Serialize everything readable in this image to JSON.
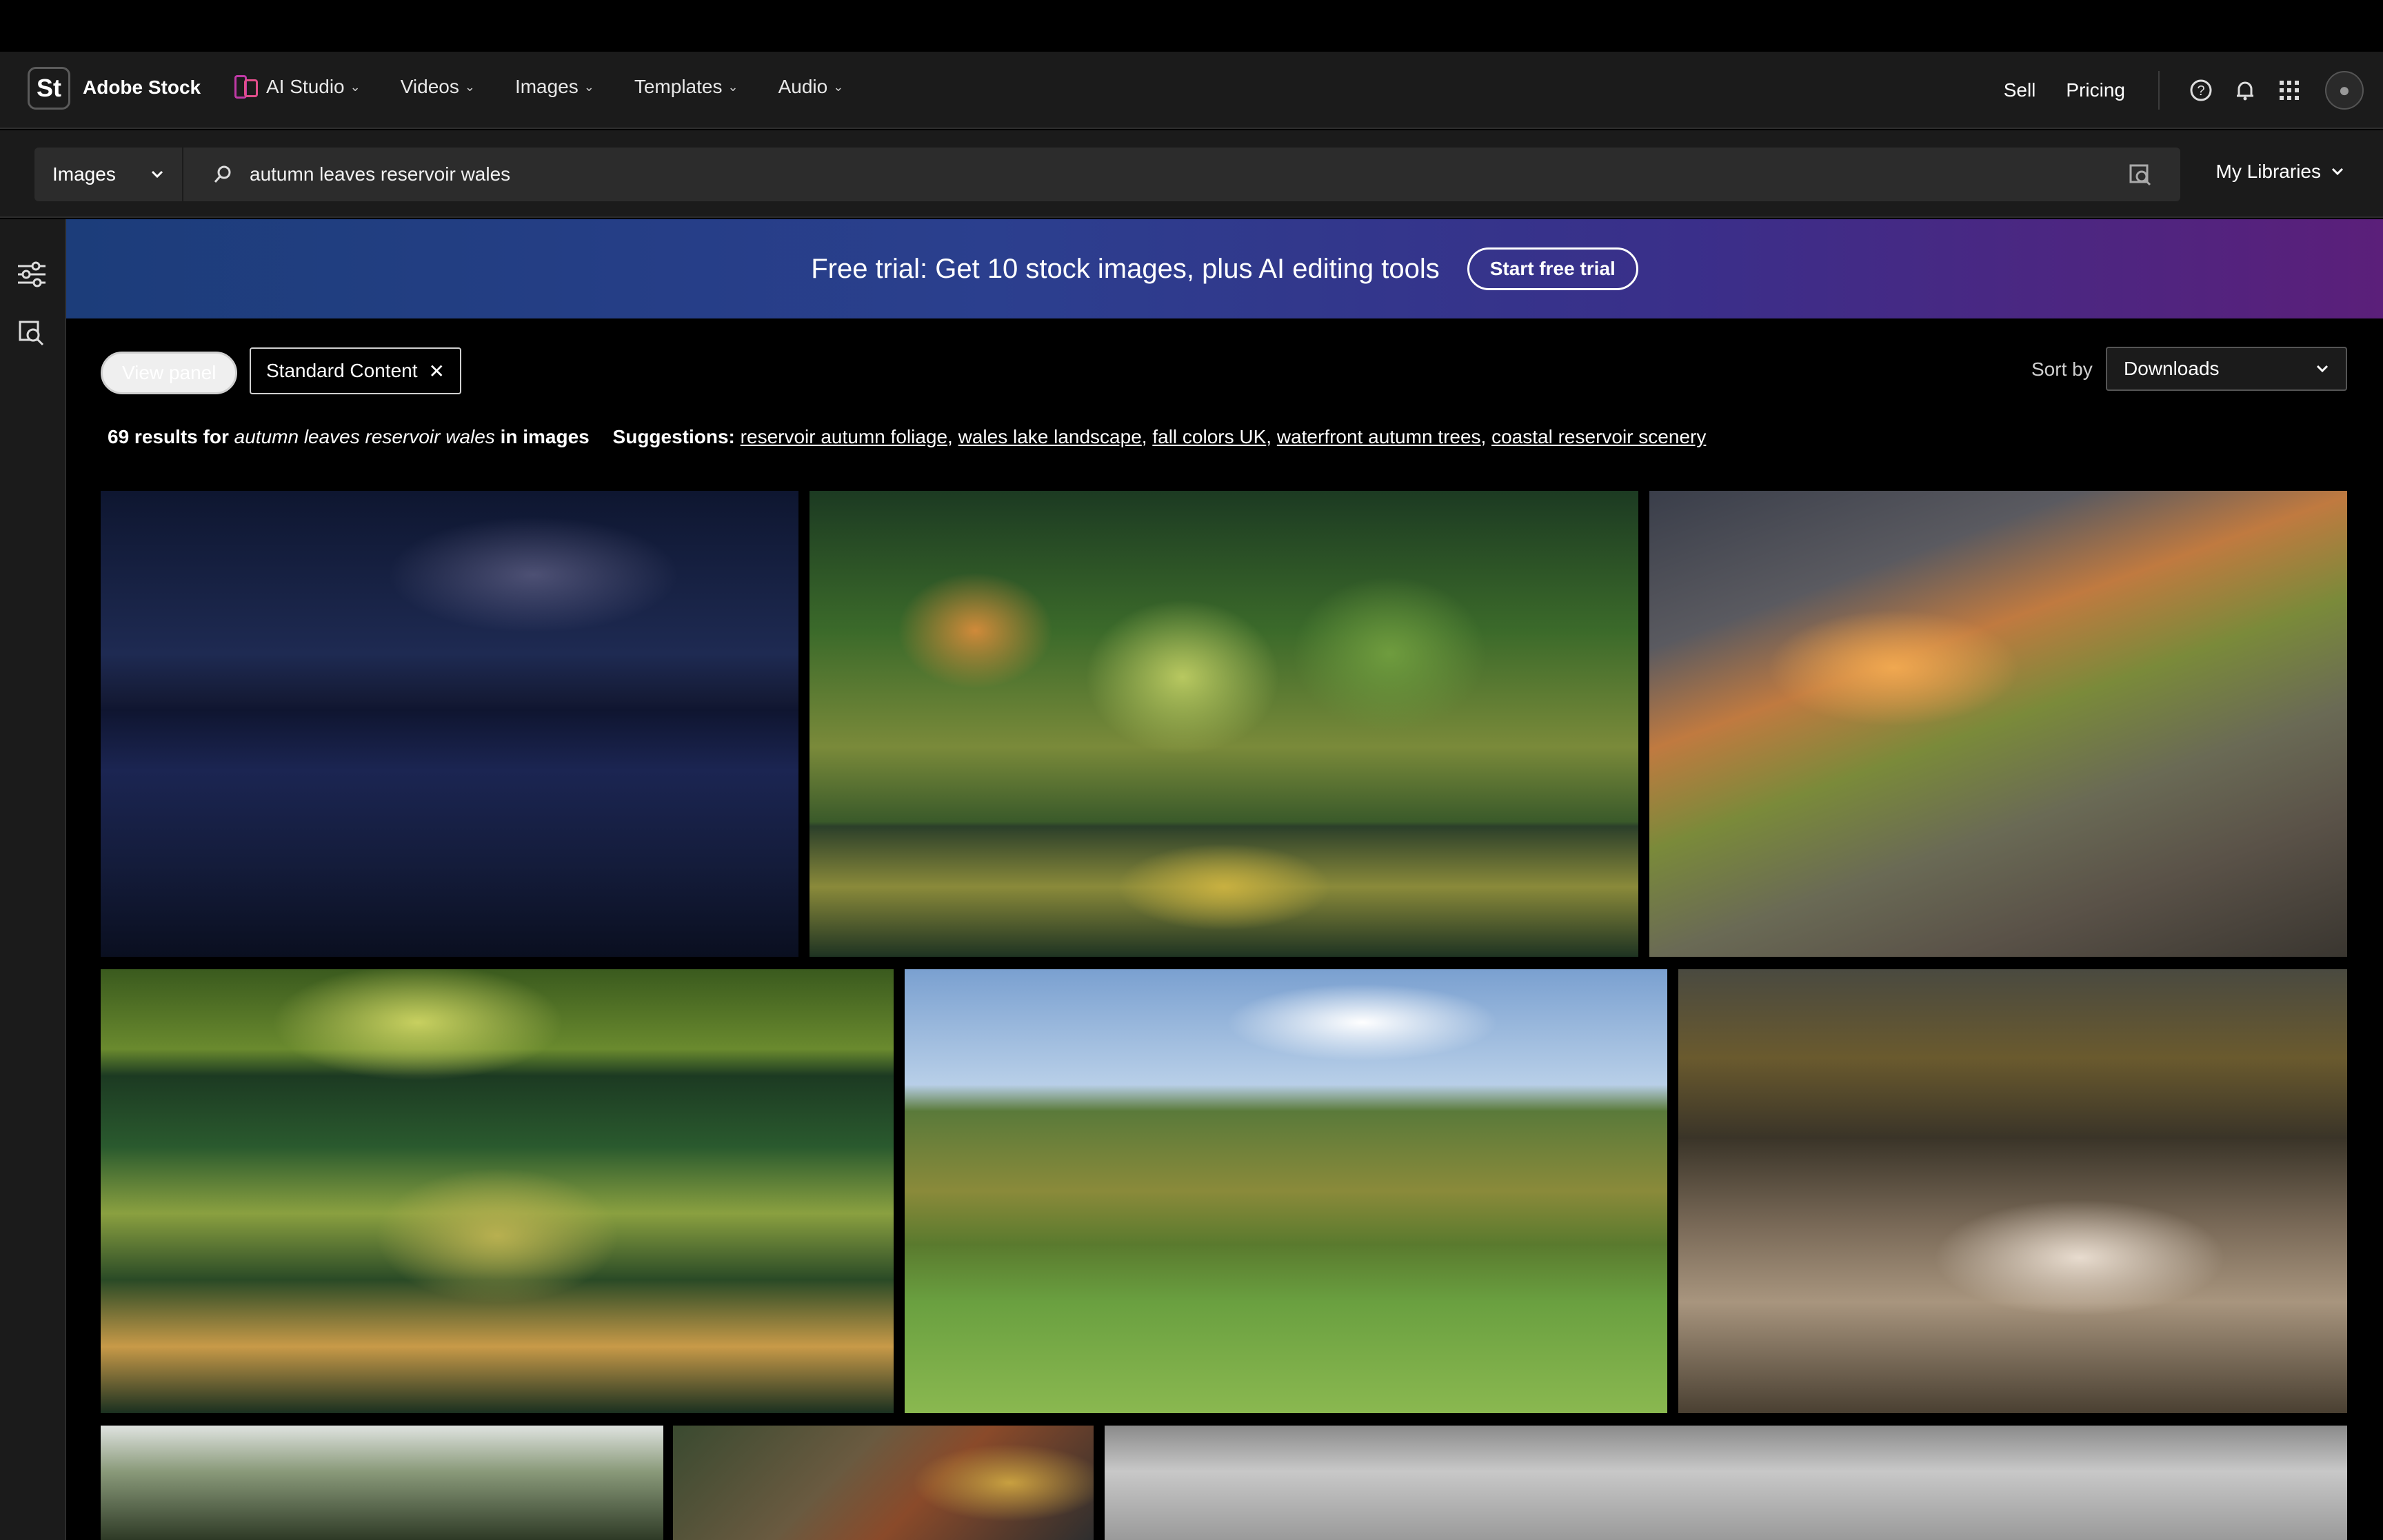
{
  "header": {
    "logo_text": "St",
    "brand": "Adobe Stock",
    "nav": [
      {
        "label": "AI Studio",
        "icon": "ai-studio-icon"
      },
      {
        "label": "Videos"
      },
      {
        "label": "Images"
      },
      {
        "label": "Templates"
      },
      {
        "label": "Audio"
      }
    ],
    "sell": "Sell",
    "pricing": "Pricing",
    "icons": [
      "help-icon",
      "bell-icon",
      "apps-grid-icon",
      "avatar"
    ]
  },
  "search": {
    "scope": "Images",
    "query": "autumn leaves reservoir wales",
    "my_libraries": "My Libraries"
  },
  "banner": {
    "message": "Free trial: Get 10 stock images, plus AI editing tools",
    "cta": "Start free trial",
    "gradient": [
      "#1c3d7a",
      "#5b1f7a"
    ]
  },
  "filters": {
    "view_panel": "View panel",
    "chip": "Standard Content",
    "sort_label": "Sort by",
    "sort_value": "Downloads"
  },
  "results": {
    "count_text": "69 results for",
    "query": "autumn leaves reservoir wales",
    "suffix": "in images",
    "suggestions_label": "Suggestions:",
    "suggestions": [
      "reservoir autumn foliage",
      "wales lake landscape",
      "fall colors UK",
      "waterfront autumn trees",
      "coastal reservoir scenery"
    ]
  },
  "images": [
    {
      "name": "night-sky-reservoir"
    },
    {
      "name": "autumn-forest-reflection"
    },
    {
      "name": "sunset-lake-obelisk"
    },
    {
      "name": "lake-tree-reflection"
    },
    {
      "name": "autumn-parkland-trees"
    },
    {
      "name": "waterfall-rapids"
    },
    {
      "name": "eucalyptus-tree"
    },
    {
      "name": "aerial-village"
    },
    {
      "name": "cloudy-sky"
    }
  ]
}
